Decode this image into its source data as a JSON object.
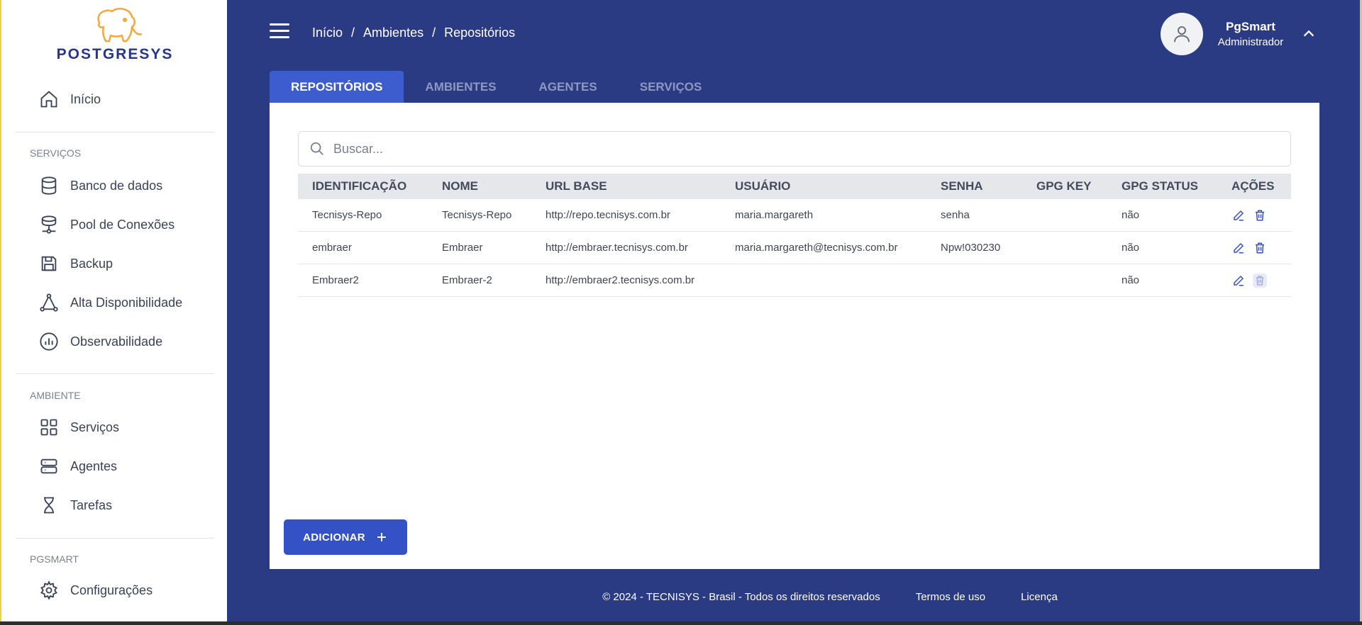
{
  "brand": {
    "name": "POSTGRESYS"
  },
  "sidebar": {
    "home": {
      "label": "Início",
      "icon": "home-icon"
    },
    "sections": [
      {
        "title": "SERVIÇOS",
        "items": [
          {
            "label": "Banco de dados",
            "icon": "database-icon"
          },
          {
            "label": "Pool de Conexões",
            "icon": "connection-pool-icon"
          },
          {
            "label": "Backup",
            "icon": "save-icon"
          },
          {
            "label": "Alta Disponibilidade",
            "icon": "triangle-network-icon"
          },
          {
            "label": "Observabilidade",
            "icon": "chart-circle-icon"
          }
        ]
      },
      {
        "title": "AMBIENTE",
        "items": [
          {
            "label": "Serviços",
            "icon": "grid-icon"
          },
          {
            "label": "Agentes",
            "icon": "server-icon"
          },
          {
            "label": "Tarefas",
            "icon": "hourglass-icon"
          }
        ]
      },
      {
        "title": "PGSMART",
        "items": [
          {
            "label": "Configurações",
            "icon": "gear-icon"
          }
        ]
      }
    ]
  },
  "header": {
    "breadcrumb": [
      "Início",
      "Ambientes",
      "Repositórios"
    ],
    "separator": "/",
    "user": {
      "name": "PgSmart",
      "role": "Administrador"
    }
  },
  "tabs": [
    "REPOSITÓRIOS",
    "AMBIENTES",
    "AGENTES",
    "SERVIÇOS"
  ],
  "search": {
    "placeholder": "Buscar..."
  },
  "table": {
    "headers": [
      "IDENTIFICAÇÃO",
      "NOME",
      "URL BASE",
      "USUÁRIO",
      "SENHA",
      "GPG KEY",
      "GPG STATUS",
      "AÇÕES"
    ],
    "rows": [
      [
        "Tecnisys-Repo",
        "Tecnisys-Repo",
        "http://repo.tecnisys.com.br",
        "maria.margareth",
        "senha",
        "",
        "não"
      ],
      [
        "embraer",
        "Embraer",
        "http://embraer.tecnisys.com.br",
        "maria.margareth@tecnisys.com.br",
        "Npw!030230",
        "",
        "não"
      ],
      [
        "Embraer2",
        "Embraer-2",
        "http://embraer2.tecnisys.com.br",
        "",
        "",
        "",
        "não"
      ]
    ]
  },
  "add_button": {
    "label": "ADICIONAR"
  },
  "footer": {
    "copyright": "© 2024 - TECNISYS - Brasil - Todos os direitos reservados",
    "terms": "Termos de uso",
    "license": "Licença"
  },
  "colors": {
    "header_bg": "#2a3a83",
    "accent": "#3d5ccd",
    "logo_orange": "#f4a83a",
    "icon_blue": "#3451c5"
  }
}
